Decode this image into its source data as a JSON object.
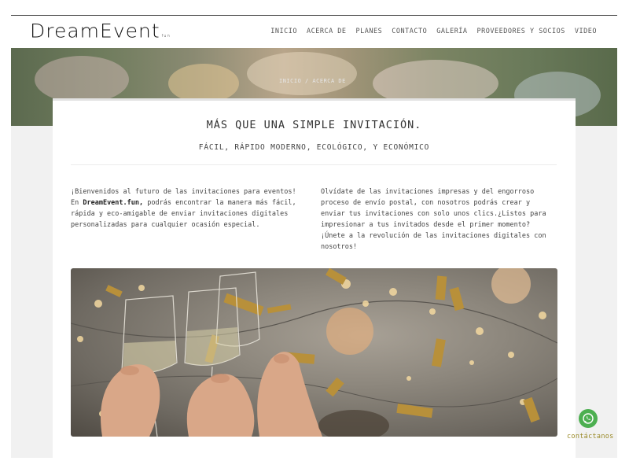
{
  "brand": {
    "logo_main": "DreamEvent",
    "logo_suffix": "fun"
  },
  "nav": {
    "items": [
      "INICIO",
      "ACERCA DE",
      "PLANES",
      "CONTACTO",
      "GALERÍA",
      "PROVEEDORES Y SOCIOS",
      "VIDEO"
    ]
  },
  "banner": {
    "breadcrumb": "INICIO / ACERCA DE"
  },
  "main": {
    "title": "MÁS QUE UNA SIMPLE INVITACIÓN.",
    "subtitle": "FÁCIL, RÁPIDO MODERNO, ECOLÓGICO, Y ECONÓMICO",
    "left_text_before": "¡Bienvenidos al futuro de las invitaciones para eventos! En ",
    "left_text_brand": "DreamEvent.fun,",
    "left_text_after": " podrás encontrar la manera más fácil, rápida y eco-amigable de enviar invitaciones digitales personalizadas para cualquier ocasión especial.",
    "right_text": "Olvídate de las invitaciones impresas y del engorroso proceso de envío postal, con nosotros podrás crear y enviar tus invitaciones con solo unos clics.¿Listos para impresionar a tus invitados desde el primer momento? ¡Únete a la revolución de las invitaciones digitales con nosotros!"
  },
  "whatsapp": {
    "label": "contáctanos",
    "icon": "whatsapp-icon",
    "color": "#4caf50"
  },
  "colors": {
    "accent_label": "#9a8a28",
    "background": "#f1f1f1"
  }
}
